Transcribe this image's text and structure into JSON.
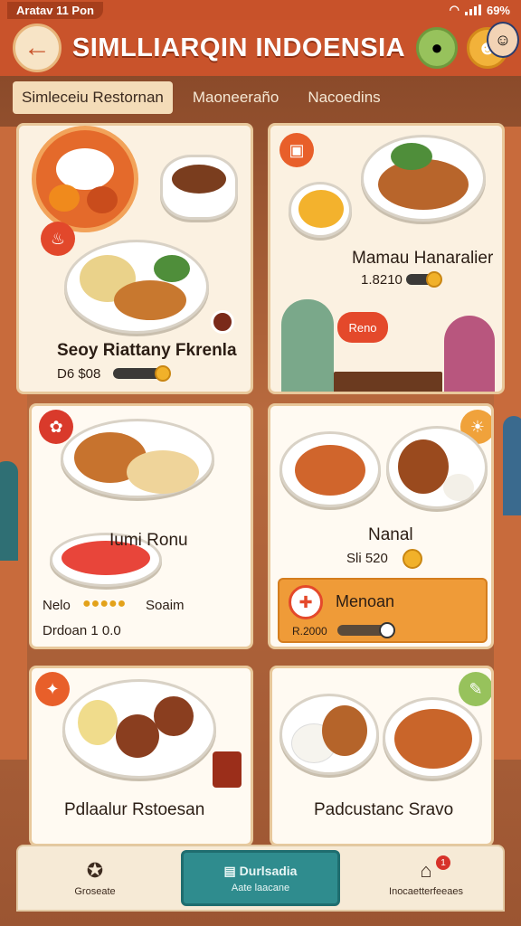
{
  "status_bar": {
    "left": "Aratav 11 Pon",
    "battery": "69%"
  },
  "header": {
    "title": "SIMLLIARQIN INDOENSIA",
    "back_label": "←"
  },
  "tabs": [
    {
      "label": "Simleceiu Restornan",
      "active": true
    },
    {
      "label": "Maoneeraño"
    },
    {
      "label": "Nacoedins"
    }
  ],
  "cards": [
    {
      "title": "Seoy Riattany Fkrenla",
      "sub": "D6 $08",
      "slider": 0.85
    },
    {
      "title": "Mamau Hanaralier",
      "sub": "1.8210",
      "slider": 0.8,
      "bubble": "Reno"
    },
    {
      "title": "Iumi Ronu",
      "rating_label": "Nelo",
      "rating_after": "Soaim",
      "sub": "Drdoan 1 0.0",
      "rating": 5
    },
    {
      "title": "Nanal",
      "sub": "Sli 520",
      "banner": "Menoan",
      "banner_sub": "R.2000",
      "slider": 0.9
    },
    {
      "title": "Pdlaalur Rstoesan"
    },
    {
      "title": "Padcustanc Sravo"
    }
  ],
  "bottom_nav": [
    {
      "label": "Groseate",
      "icon": "star-icon"
    },
    {
      "label": "Durlsadia",
      "sub": "Aate laacane",
      "icon": "menu-icon",
      "active": true
    },
    {
      "label": "Inocaetterfeeaes",
      "icon": "tray-icon",
      "badge": "1"
    }
  ],
  "colors": {
    "header": "#c9532b",
    "accent": "#f1b12a",
    "nav_active": "#2f8c8e"
  }
}
